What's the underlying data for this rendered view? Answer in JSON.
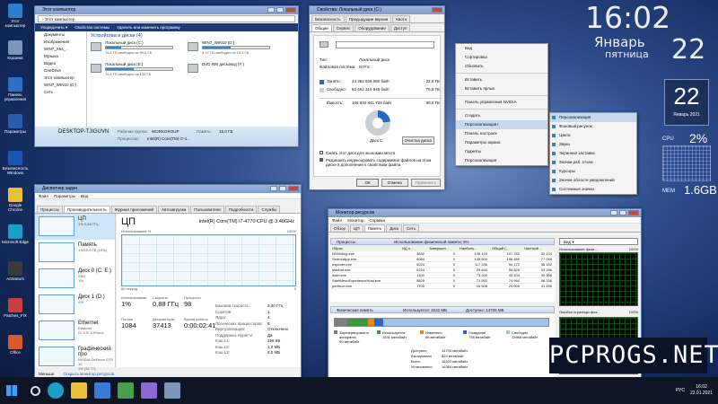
{
  "desktop": {
    "icons": [
      {
        "label": "Этот компьютер",
        "color": "#2a7fd1"
      },
      {
        "label": "Корзина",
        "color": "#7f95b8"
      },
      {
        "label": "Панель управления",
        "color": "#2d6ec6"
      },
      {
        "label": "Параметры",
        "color": "#2b5bb0"
      },
      {
        "label": "Безопасность Windows",
        "color": "#1d56b0"
      },
      {
        "label": "Google Chrome",
        "color": "#e8c03a"
      },
      {
        "label": "Microsoft Edge",
        "color": "#1aa0c8"
      },
      {
        "label": "Activators",
        "color": "#3a3a3a"
      },
      {
        "label": "Patches_FIX",
        "color": "#c8403c"
      },
      {
        "label": "Office",
        "color": "#d85a2a"
      }
    ]
  },
  "explorer": {
    "title": "Этот компьютер",
    "nav": [
      "Упорядочить ▾",
      "Свойства системы",
      "Удалить или изменить программу"
    ],
    "address": "› Этот компьютер",
    "section": "Устройства и диски (4)",
    "sidebar": [
      "Документы",
      "Изображения",
      "WIN7_X64_..",
      "Музыка",
      "Видео",
      "OneDrive",
      "Этот компьютер",
      "WIN7_WIN10 (D:)",
      "Сеть"
    ],
    "drives": [
      {
        "name": "Локальный диск (C:)",
        "free": "76,5 ГБ свободно из 99,5 ГБ",
        "fill": 0.23
      },
      {
        "name": "WIN7_WIN10 (D:)",
        "free": "9,47 ГБ свободно из 16,3 ГБ",
        "fill": 0.42
      },
      {
        "name": "Локальный диск (E:)",
        "free": "76,5 ГБ свободно из 132 ГБ",
        "fill": 0.42
      },
      {
        "name": "DVD RW дисковод (F:)",
        "free": "",
        "fill": 0
      }
    ],
    "footer": {
      "pc": "DESKTOP-TJIGUVN",
      "group_label": "Рабочая группа:",
      "group": "WORKGROUP",
      "mem_label": "Память:",
      "mem": "16,0 ГБ",
      "cpu_label": "Процессор:",
      "cpu": "Intel(R) Core(TM) i7-4..."
    }
  },
  "props": {
    "title": "Свойства: Локальный диск (C:)",
    "tabs_row1": [
      "Безопасность",
      "Предыдущие версии",
      "Квота"
    ],
    "tabs_row2": [
      "Общие",
      "Сервис",
      "Оборудование",
      "Доступ"
    ],
    "type_label": "Тип:",
    "type": "Локальный диск",
    "fs_label": "Файловая система:",
    "fs": "NTFS",
    "used_label": "Занято:",
    "used_bytes": "24 362 926 080 байт",
    "used_gb": "22,6 ГБ",
    "free_label": "Свободно:",
    "free_bytes": "82 462 315 840 байт",
    "free_gb": "76,8 ГБ",
    "cap_label": "Ёмкость:",
    "cap_bytes": "106 840 841 728 байт",
    "cap_gb": "99,5 ГБ",
    "disk_label": "Диск C:",
    "cleanup": "Очистка диска",
    "chk1": "Сжать этот диск для экономии места",
    "chk2": "Разрешить индексировать содержимое файлов на этом диске в дополнение к свойствам файла",
    "used_frac": 0.23,
    "buttons": [
      "ОК",
      "Отмена",
      "Применить"
    ]
  },
  "context_menu": {
    "items": [
      "Вид",
      "Сортировка",
      "Обновить",
      "Вставить",
      "Вставить ярлык",
      "Панель управления NVIDIA",
      "Создать",
      "Персонализация+",
      "Панель настроек",
      "Параметры экрана",
      "Гаджеты",
      "Персонализация"
    ]
  },
  "submenu": {
    "items": [
      "Персонализация",
      "Фоновый рисунок",
      "Цвета",
      "Звуки",
      "Экранная заставка",
      "Значки раб. стола",
      "Курсоры",
      "Значки области уведомлений",
      "Системные значки"
    ]
  },
  "clock": {
    "time": "16:02",
    "month": "Январь",
    "weekday": "пятница",
    "day": "22",
    "cal_day": "22",
    "cal_month": "Январь 2021",
    "cpu_label": "CPU",
    "cpu_val": "2%",
    "mem_label": "МЕМ",
    "mem_val": "1.6GB"
  },
  "taskmgr": {
    "title": "Диспетчер задач",
    "menu": [
      "Файл",
      "Параметры",
      "Вид"
    ],
    "tabs": [
      "Процессы",
      "Производительность",
      "Журнал приложений",
      "Автозагрузка",
      "Пользователи",
      "Подробности",
      "Службы"
    ],
    "side": [
      {
        "name": "ЦП",
        "sub": "1% 0,88 ГГц"
      },
      {
        "name": "Память",
        "sub": "1,6/15,9 ГБ (10%)"
      },
      {
        "name": "Диск 0 (C: E:)",
        "sub": "SSD\n1%"
      },
      {
        "name": "Диск 1 (D:)",
        "sub": "0%"
      },
      {
        "name": "Ethernet",
        "sub": "Ethernet\nО: 0 П: 0 Кбит/с"
      },
      {
        "name": "Графический про",
        "sub": "NVIDIA GeForce GTX 10\n1% (32 °C)"
      }
    ],
    "cpu_title": "ЦП",
    "cpu_model": "Intel(R) Core(TM) i7-4770 CPU @ 3.40GHz",
    "util_label": "Использование %",
    "util_max": "100%",
    "secs": "60 секунд",
    "zero": "0",
    "stats": [
      {
        "l": "Использование",
        "v": "1%"
      },
      {
        "l": "Скорость",
        "v": "0,88 ГГц"
      },
      {
        "l": "Процессы",
        "v": "98"
      },
      {
        "l": "Потоки",
        "v": "1084"
      },
      {
        "l": "Дескрипторы",
        "v": "37413"
      },
      {
        "l": "Время работы",
        "v": "0:00:02:41"
      }
    ],
    "specs": [
      [
        "Базовая скорость:",
        "3,40 ГГц"
      ],
      [
        "Сокетов:",
        "1"
      ],
      [
        "Ядра:",
        "4"
      ],
      [
        "Логических процессоров:",
        "8"
      ],
      [
        "Виртуализация:",
        "Отключено"
      ],
      [
        "Поддержка Hyper-V:",
        "Да"
      ],
      [
        "Кэш L1:",
        "256 КБ"
      ],
      [
        "Кэш L2:",
        "1,0 МБ"
      ],
      [
        "Кэш L3:",
        "8,0 МБ"
      ]
    ],
    "footer_less": "Меньше",
    "footer_link": "Открыть монитор ресурсов"
  },
  "resmon": {
    "title": "Монитор ресурсов",
    "menu": [
      "Файл",
      "Монитор",
      "Справка"
    ],
    "tabs": [
      "Обзор",
      "ЦП",
      "Память",
      "Диск",
      "Сеть"
    ],
    "proc_head": "Процессы",
    "mem_use": "Использование физической памяти: 9%",
    "cols": [
      "Образ",
      "ИД п...",
      "Завершен...",
      "Наиболь...",
      "Общий (...",
      "Частный ..."
    ],
    "rows": [
      [
        "NVMsting.exe",
        "3632",
        "0",
        "135 120",
        "107 252",
        "32 224"
      ],
      [
        "SearchApp.exe",
        "6064",
        "0",
        "135 500",
        "146 480",
        "77 056"
      ],
      [
        "explorer.exe",
        "5224",
        "0",
        "117 236",
        "94 172",
        "36 152"
      ],
      [
        "sidebar.exe",
        "5224",
        "0",
        "29 640",
        "55 820",
        "33 256"
      ],
      [
        "dwm.exe",
        "1100",
        "0",
        "73 200",
        "43 104",
        "30 008"
      ],
      [
        "StartMenuExperienceHost.exe",
        "5820",
        "0",
        "71 592",
        "74 992",
        "56 336"
      ],
      [
        "perfmon.exe",
        "7700",
        "0",
        "16 508",
        "24 000",
        "31 456"
      ]
    ],
    "mem_head": "Физическая память",
    "mem_inuse": "Используется: 1531 МБ",
    "mem_avail": "Доступно: 14705 МБ",
    "legend": [
      {
        "l": "Зарезервировано аппаратно",
        "v": "90 мегабайт",
        "c": "#7f7f7f"
      },
      {
        "l": "Используется",
        "v": "1531 мегабайт",
        "c": "#3a9a3a"
      },
      {
        "l": "Изменено",
        "v": "86 мегабайт",
        "c": "#e28a1a"
      },
      {
        "l": "Ожидание",
        "v": "738 мегабайт",
        "c": "#2a66c8"
      },
      {
        "l": "Свободно",
        "v": "13966 мегабайт",
        "c": "#9fc3ef"
      }
    ],
    "totals": [
      [
        "Доступно",
        "14705 мегабайт"
      ],
      [
        "Кэшировано",
        "824 мегабайт"
      ],
      [
        "Всего",
        "16322 мегабайт"
      ],
      [
        "Установлено",
        "16384 мегабайт"
      ]
    ],
    "view_label": "Вид",
    "g1": "Использование физи...",
    "g1v": "100%",
    "g2": "Ошибок страницы физ...",
    "g2v": "100%"
  },
  "taskbar": {
    "time": "16:02",
    "date": "22.01.2021",
    "lang": "РУС"
  },
  "watermark": "PCPROGS.NET"
}
